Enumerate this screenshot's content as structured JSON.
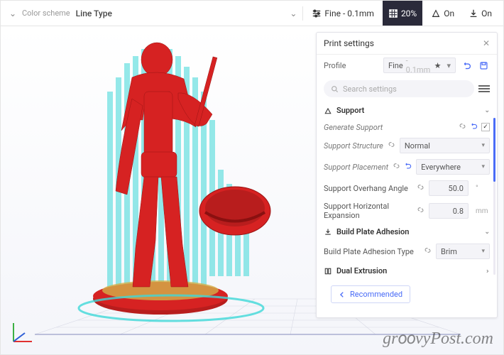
{
  "topbar": {
    "color_scheme_label": "Color scheme",
    "color_scheme_value": "Line Type",
    "quality": "Fine - 0.1mm",
    "infill": "20%",
    "support_on": "On",
    "adhesion_on": "On"
  },
  "panel": {
    "title": "Print settings",
    "profile_label": "Profile",
    "profile_value": "Fine",
    "profile_suffix": "- 0.1mm",
    "search_placeholder": "Search settings",
    "sections": {
      "support": {
        "title": "Support",
        "generate_label": "Generate Support",
        "generate_checked": true,
        "structure_label": "Support Structure",
        "structure_value": "Normal",
        "placement_label": "Support Placement",
        "placement_value": "Everywhere",
        "overhang_label": "Support Overhang Angle",
        "overhang_value": "50.0",
        "horiz_exp_label": "Support Horizontal Expansion",
        "horiz_exp_value": "0.8",
        "horiz_exp_unit": "mm"
      },
      "adhesion": {
        "title": "Build Plate Adhesion",
        "type_label": "Build Plate Adhesion Type",
        "type_value": "Brim"
      },
      "dual_extrusion": {
        "title": "Dual Extrusion"
      }
    },
    "recommended_label": "Recommended"
  },
  "watermark": "groovyPost.com"
}
